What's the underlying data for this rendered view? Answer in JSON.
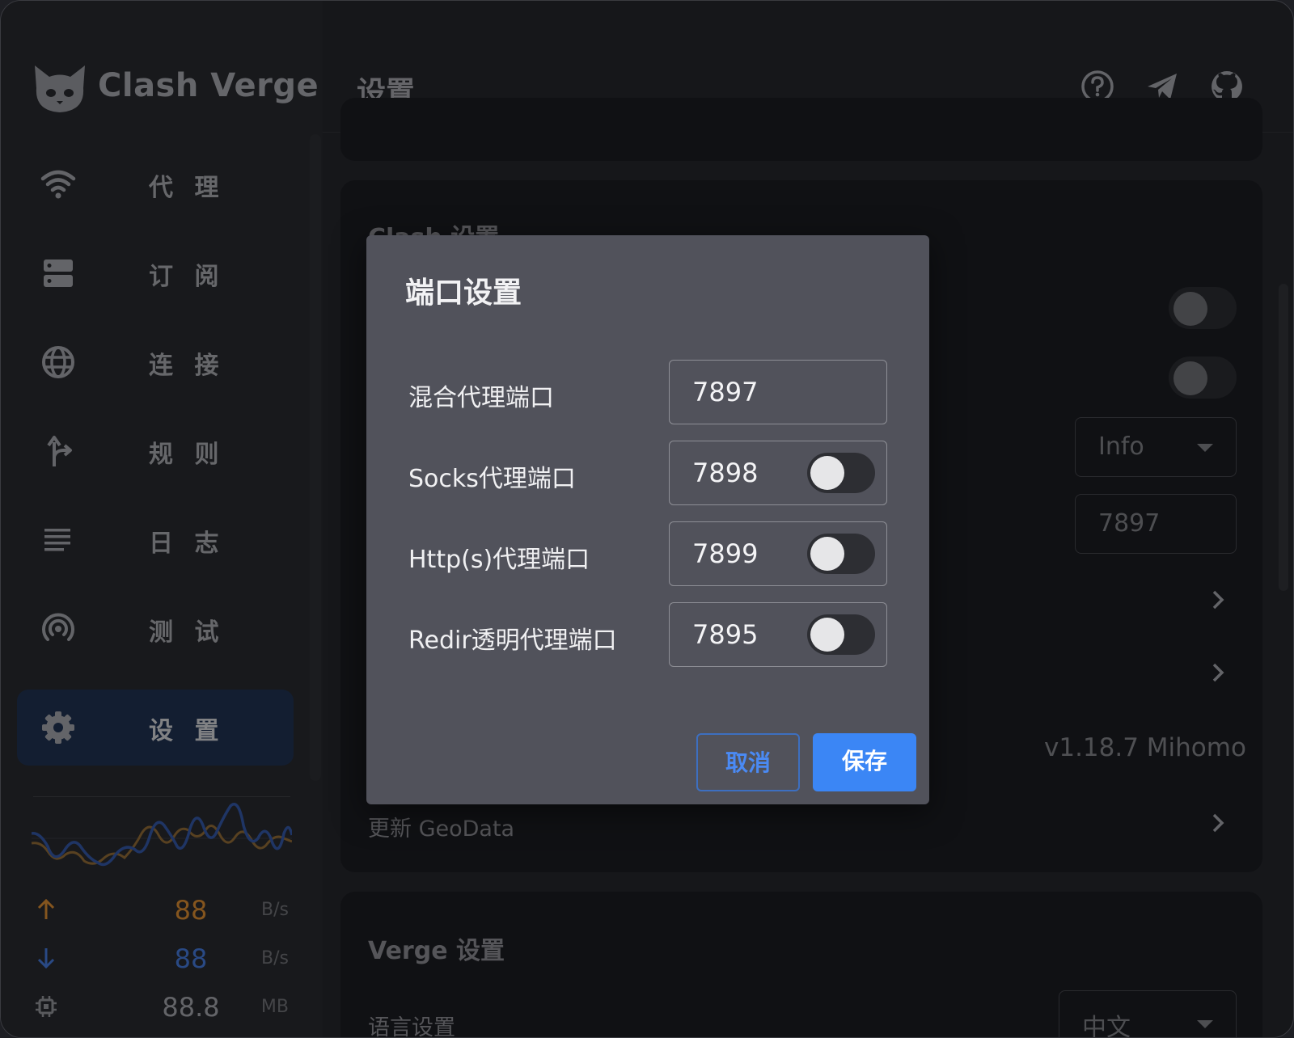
{
  "app": {
    "name": "Clash Verge"
  },
  "sidebar": {
    "items": [
      {
        "label": "代 理",
        "icon": "wifi-icon"
      },
      {
        "label": "订 阅",
        "icon": "server-icon"
      },
      {
        "label": "连 接",
        "icon": "globe-icon"
      },
      {
        "label": "规 则",
        "icon": "fork-arrow-icon"
      },
      {
        "label": "日 志",
        "icon": "lines-icon"
      },
      {
        "label": "测 试",
        "icon": "radar-icon"
      },
      {
        "label": "设 置",
        "icon": "gear-icon",
        "active": true
      }
    ],
    "stats": {
      "upload": {
        "value": "88",
        "unit": "B/s",
        "color": "#b8762a"
      },
      "download": {
        "value": "88",
        "unit": "B/s",
        "color": "#3a66b8"
      },
      "memory": {
        "value": "88.8",
        "unit": "MB"
      }
    }
  },
  "header": {
    "title": "设置",
    "icons": [
      "help-icon",
      "telegram-icon",
      "github-icon"
    ]
  },
  "clash_section": {
    "title": "Clash 设置",
    "log_level": "Info",
    "port_value": "7897",
    "version": "v1.18.7 Mihomo",
    "update_geodata_label": "更新 GeoData"
  },
  "verge_section": {
    "title": "Verge 设置",
    "language_label": "语言设置",
    "language_value": "中文"
  },
  "dialog": {
    "title": "端口设置",
    "rows": [
      {
        "label": "混合代理端口",
        "value": "7897",
        "has_toggle": false
      },
      {
        "label": "Socks代理端口",
        "value": "7898",
        "has_toggle": true,
        "enabled": false
      },
      {
        "label": "Http(s)代理端口",
        "value": "7899",
        "has_toggle": true,
        "enabled": false
      },
      {
        "label": "Redir透明代理端口",
        "value": "7895",
        "has_toggle": true,
        "enabled": false
      }
    ],
    "cancel_label": "取消",
    "save_label": "保存"
  },
  "colors": {
    "accent": "#3b86f5",
    "sidebar_active": "#1b2a45",
    "dialog_bg": "#51525b"
  }
}
